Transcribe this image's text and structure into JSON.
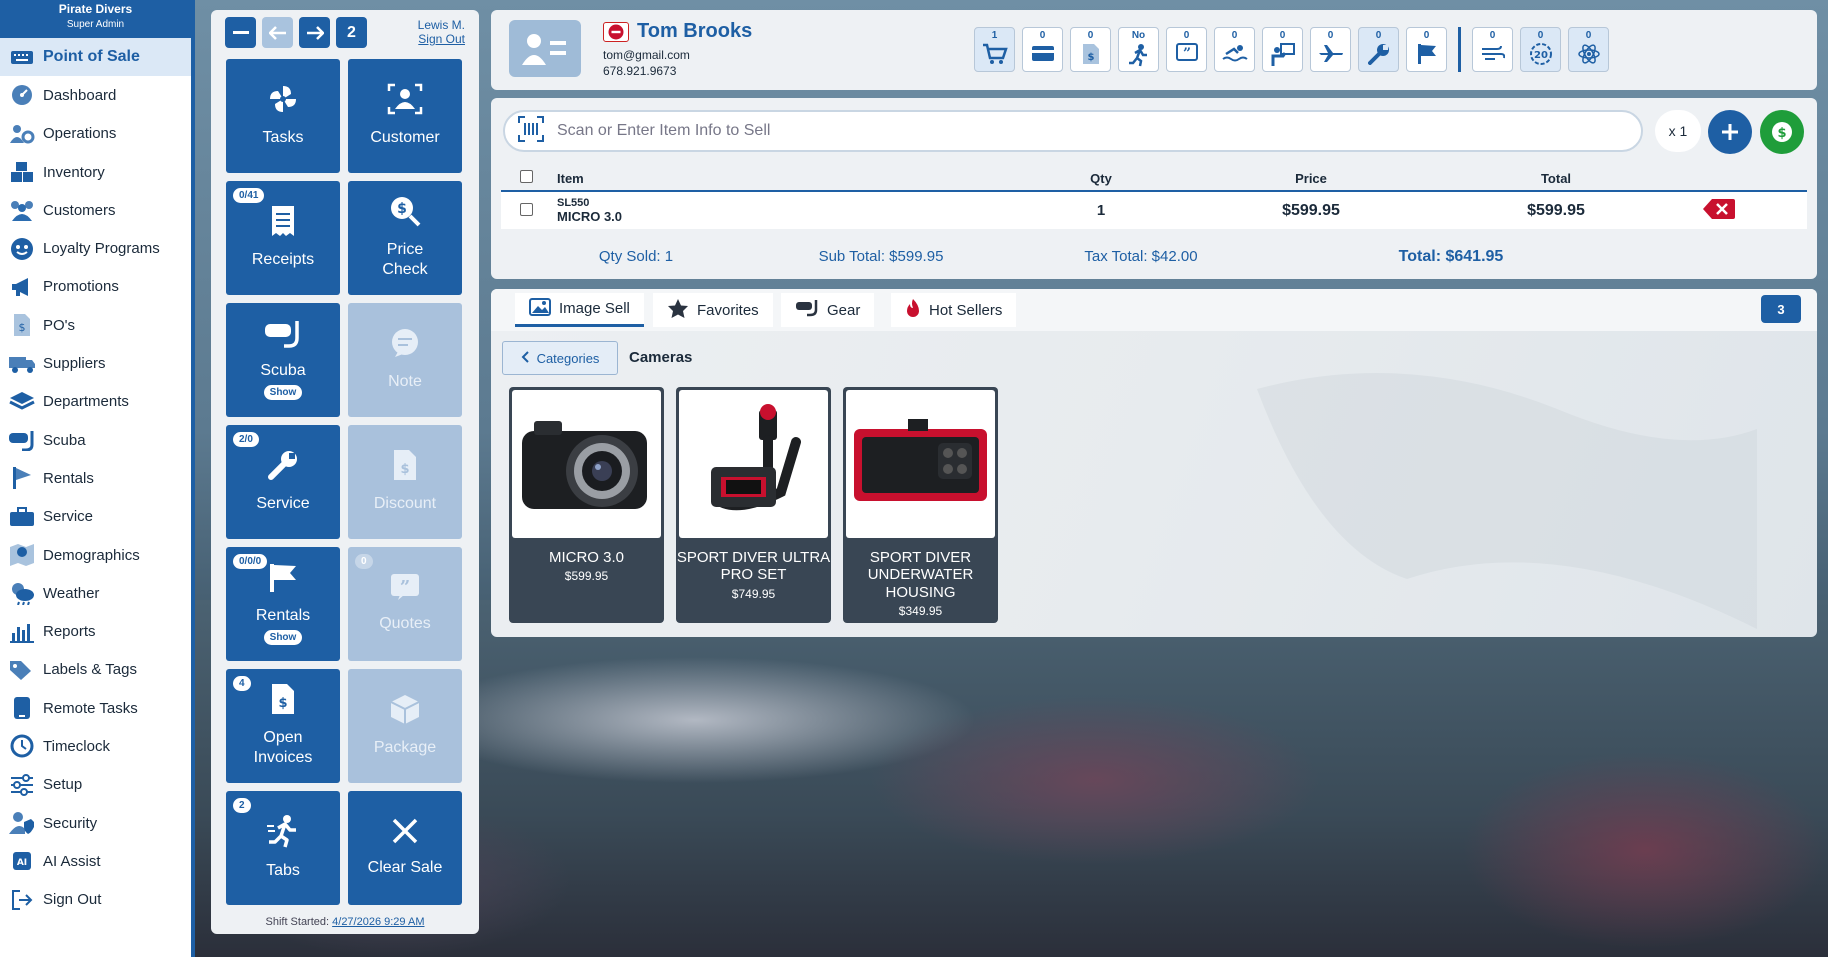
{
  "sidebar": {
    "brand": "Pirate Divers",
    "role": "Super Admin",
    "items": [
      {
        "label": "Point of Sale",
        "active": true
      },
      {
        "label": "Dashboard"
      },
      {
        "label": "Operations"
      },
      {
        "label": "Inventory"
      },
      {
        "label": "Customers"
      },
      {
        "label": "Loyalty Programs"
      },
      {
        "label": "Promotions"
      },
      {
        "label": "PO's"
      },
      {
        "label": "Suppliers"
      },
      {
        "label": "Departments"
      },
      {
        "label": "Scuba"
      },
      {
        "label": "Rentals"
      },
      {
        "label": "Service"
      },
      {
        "label": "Demographics"
      },
      {
        "label": "Weather"
      },
      {
        "label": "Reports"
      },
      {
        "label": "Labels & Tags"
      },
      {
        "label": "Remote Tasks"
      },
      {
        "label": "Timeclock"
      },
      {
        "label": "Setup"
      },
      {
        "label": "Security"
      },
      {
        "label": "AI Assist"
      },
      {
        "label": "Sign Out"
      }
    ]
  },
  "quick": {
    "tab_count": "2",
    "user_name": "Lewis M.",
    "sign_out": "Sign Out",
    "tiles": {
      "tasks": "Tasks",
      "customer": "Customer",
      "receipts": "Receipts",
      "receipts_badge": "0/41",
      "price_check_1": "Price",
      "price_check_2": "Check",
      "scuba": "Scuba",
      "scuba_show": "Show",
      "note": "Note",
      "service": "Service",
      "service_badge": "2/0",
      "discount": "Discount",
      "rentals": "Rentals",
      "rentals_badge": "0/0/0",
      "rentals_show": "Show",
      "quotes": "Quotes",
      "quotes_badge": "0",
      "open_invoices_1": "Open",
      "open_invoices_2": "Invoices",
      "open_invoices_badge": "4",
      "package": "Package",
      "tabs": "Tabs",
      "tabs_badge": "2",
      "clear_sale": "Clear Sale"
    },
    "shift_label": "Shift Started:",
    "shift_time": "4/27/2026 9:29 AM"
  },
  "customer": {
    "name": "Tom Brooks",
    "email": "tom@gmail.com",
    "phone": "678.921.9673",
    "counters": [
      {
        "icon": "cart-icon",
        "value": "1"
      },
      {
        "icon": "card-icon",
        "value": "0"
      },
      {
        "icon": "invoice-icon",
        "value": "0"
      },
      {
        "icon": "runner-icon",
        "value": "No"
      },
      {
        "icon": "quote-icon",
        "value": "0"
      },
      {
        "icon": "swimmer-icon",
        "value": "0"
      },
      {
        "icon": "instructor-icon",
        "value": "0"
      },
      {
        "icon": "plane-icon",
        "value": "0"
      },
      {
        "icon": "wrench-icon",
        "value": "0"
      },
      {
        "icon": "flag-icon",
        "value": "0"
      },
      {
        "icon": "wind-icon",
        "value": "0"
      },
      {
        "icon": "twenty-icon",
        "value": "0"
      },
      {
        "icon": "atom-icon",
        "value": "0"
      }
    ]
  },
  "sale": {
    "scan_placeholder": "Scan or Enter Item Info to Sell",
    "qty_multiplier": "x 1",
    "columns": {
      "item": "Item",
      "qty": "Qty",
      "price": "Price",
      "total": "Total"
    },
    "rows": [
      {
        "sku": "SL550",
        "name": "MICRO 3.0",
        "qty": "1",
        "price": "$599.95",
        "total": "$599.95"
      }
    ],
    "qty_sold": "Qty Sold: 1",
    "sub_total": "Sub Total: $599.95",
    "tax_total": "Tax Total: $42.00",
    "grand_total": "Total: $641.95"
  },
  "catalog": {
    "tabs": [
      "Image Sell",
      "Favorites",
      "Gear",
      "Hot Sellers"
    ],
    "count": "3",
    "categories_button": "Categories",
    "category_title": "Cameras",
    "products": [
      {
        "name": "MICRO 3.0",
        "price": "$599.95"
      },
      {
        "name": "SPORT DIVER ULTRA PRO SET",
        "price": "$749.95"
      },
      {
        "name": "SPORT DIVER UNDERWATER HOUSING",
        "price": "$349.95"
      }
    ]
  },
  "colors": {
    "primary": "#1e5fa4",
    "success": "#1f9d3a",
    "danger": "#c8102e"
  }
}
